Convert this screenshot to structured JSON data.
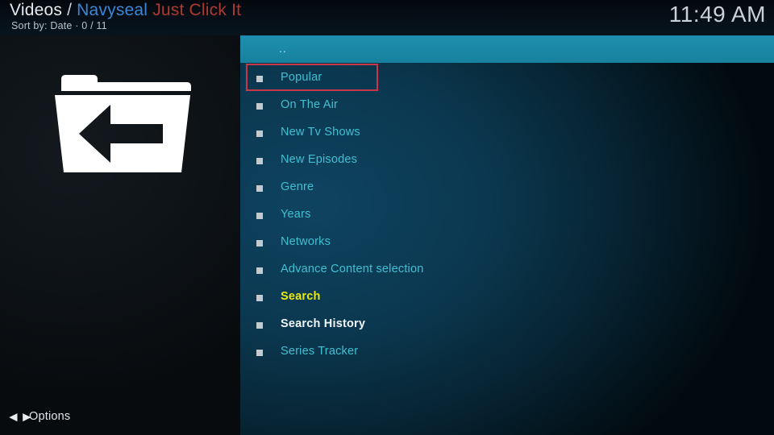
{
  "header": {
    "breadcrumb_root": "Videos",
    "breadcrumb_separator": "/",
    "breadcrumb_addon": "Navyseal",
    "breadcrumb_addon_suffix": "Just Click It",
    "subtitle": "Sort by: Date  ·  0 / 11",
    "clock": "11:49 AM",
    "colors": {
      "addon_blue": "#3b86d8",
      "addon_red": "#b0392f"
    }
  },
  "thumbnail": {
    "icon": "parent-folder-icon"
  },
  "list": {
    "parent_row": {
      "label": "..",
      "background": "#1a87a5"
    },
    "focus": {
      "index": 0,
      "border_color": "#c8384a"
    },
    "items": [
      {
        "label": "Popular",
        "color": "#3fc0d2",
        "style": "normal"
      },
      {
        "label": "On The Air",
        "color": "#3fc0d2",
        "style": "normal"
      },
      {
        "label": "New Tv Shows",
        "color": "#3fc0d2",
        "style": "normal"
      },
      {
        "label": "New Episodes",
        "color": "#3fc0d2",
        "style": "normal"
      },
      {
        "label": "Genre",
        "color": "#3fc0d2",
        "style": "normal"
      },
      {
        "label": "Years",
        "color": "#3fc0d2",
        "style": "normal"
      },
      {
        "label": "Networks",
        "color": "#3fc0d2",
        "style": "normal"
      },
      {
        "label": "Advance Content selection",
        "color": "#3fc0d2",
        "style": "normal"
      },
      {
        "label": "Search",
        "color": "#e9e90d",
        "style": "bold"
      },
      {
        "label": "Search History",
        "color": "#f2f5f7",
        "style": "bold"
      },
      {
        "label": "Series Tracker",
        "color": "#3fc0d2",
        "style": "normal"
      }
    ]
  },
  "footer": {
    "options_icon": "left-right-arrows-icon",
    "options_glyph": "◄►",
    "options_label": "Options"
  }
}
